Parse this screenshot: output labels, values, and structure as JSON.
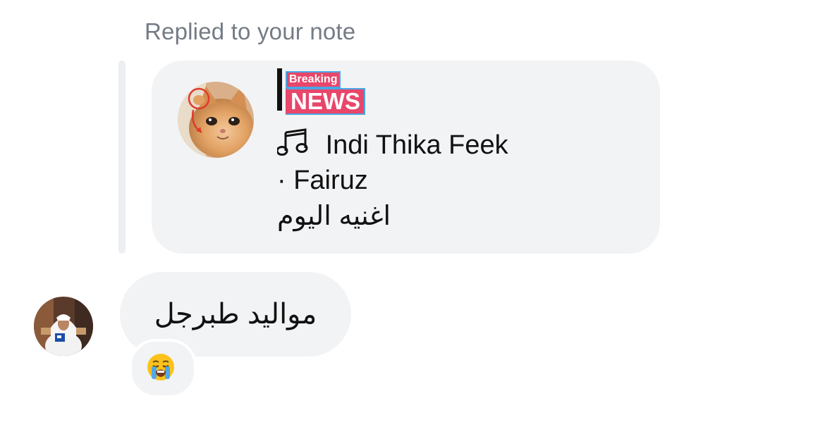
{
  "reply": {
    "label": "Replied to your note"
  },
  "note": {
    "badge_small": "Breaking",
    "badge_large": "NEWS",
    "song_title": "Indi Thika Feek",
    "artist": "· Fairuz",
    "caption": "اغنيه اليوم",
    "music_icon": "music-note-icon"
  },
  "message": {
    "text": "مواليد طبرجل",
    "reaction_icon": "loudly-crying-face-emoji"
  },
  "colors": {
    "bubble": "#f2f3f5",
    "label_gray": "#747b85",
    "badge_pink": "#e8466b",
    "badge_outline": "#4aa6e4"
  }
}
